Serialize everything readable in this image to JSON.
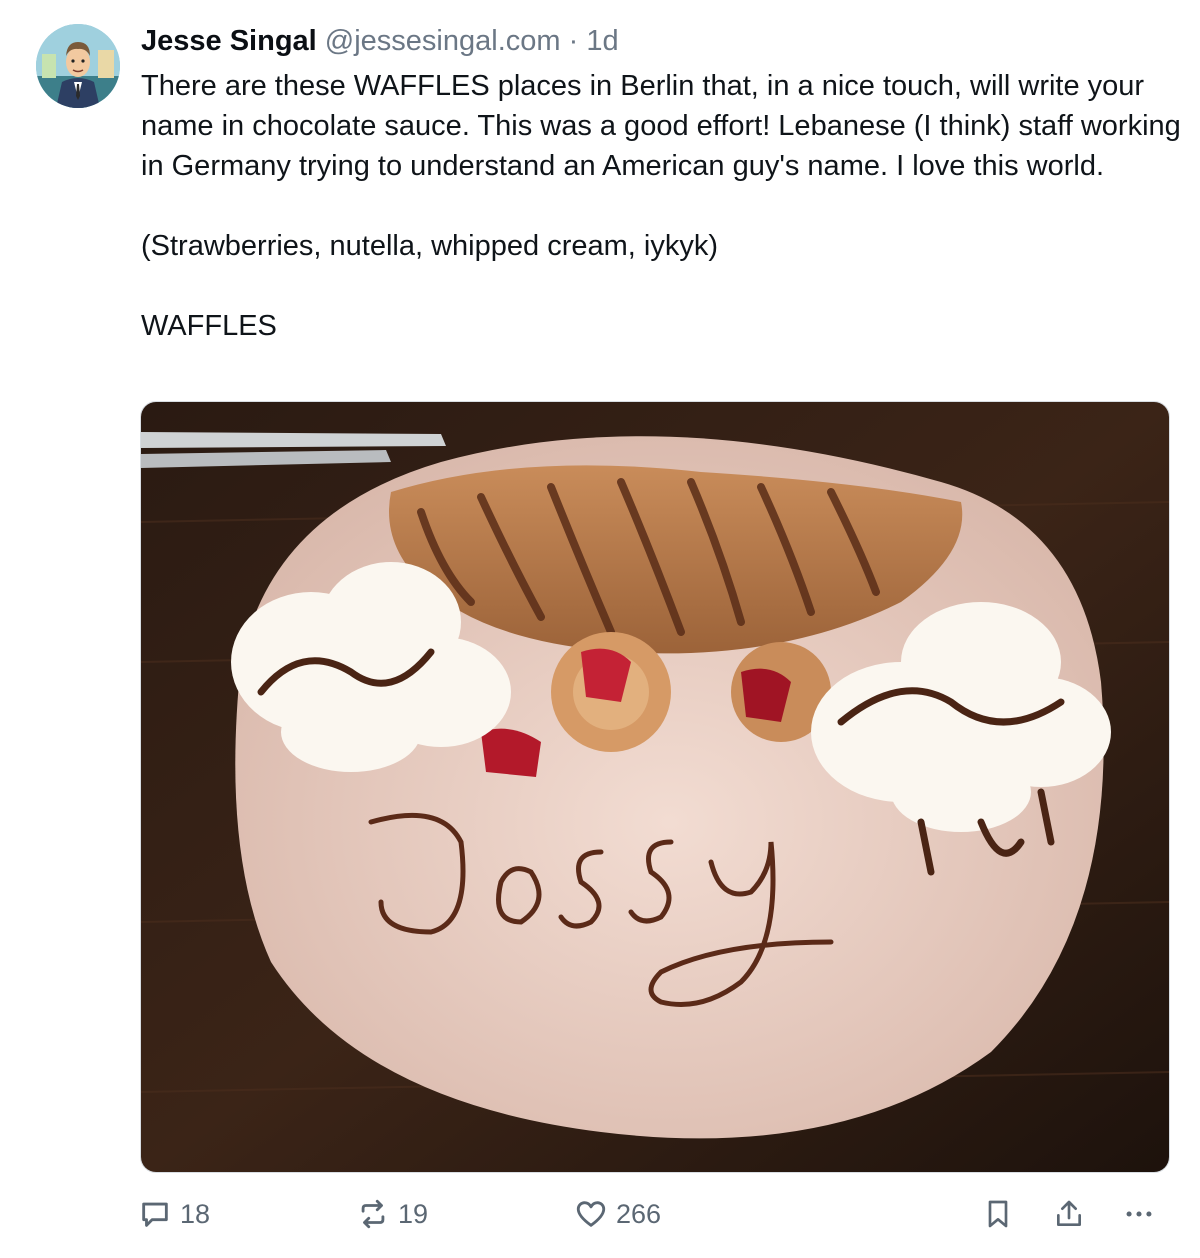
{
  "post": {
    "author": {
      "display_name": "Jesse Singal",
      "handle": "@jessesingal.com",
      "avatar_icon": "cartoon-avatar-icon"
    },
    "separator": "·",
    "timestamp": "1d",
    "text_lines": [
      "There are these WAFFLES places in Berlin that, in a nice touch, will write your name in chocolate sauce. This was a good effort! Lebanese (I think) staff working in Germany trying to understand an American guy's name. I love this world.",
      "(Strawberries, nutella, whipped cream, iykyk)",
      "WAFFLES"
    ],
    "image": {
      "icon": "waffle-plate-photo",
      "name_written": "Jassy"
    },
    "actions": {
      "reply": {
        "icon": "reply-bubble-icon",
        "count": "18"
      },
      "repost": {
        "icon": "repost-arrows-icon",
        "count": "19"
      },
      "like": {
        "icon": "heart-icon",
        "count": "266"
      },
      "bookmark": {
        "icon": "bookmark-icon"
      },
      "share": {
        "icon": "share-icon"
      },
      "more": {
        "icon": "more-dots-icon"
      }
    }
  },
  "colors": {
    "text": "#0f1419",
    "muted": "#6b7785",
    "icon": "#5b6773"
  }
}
